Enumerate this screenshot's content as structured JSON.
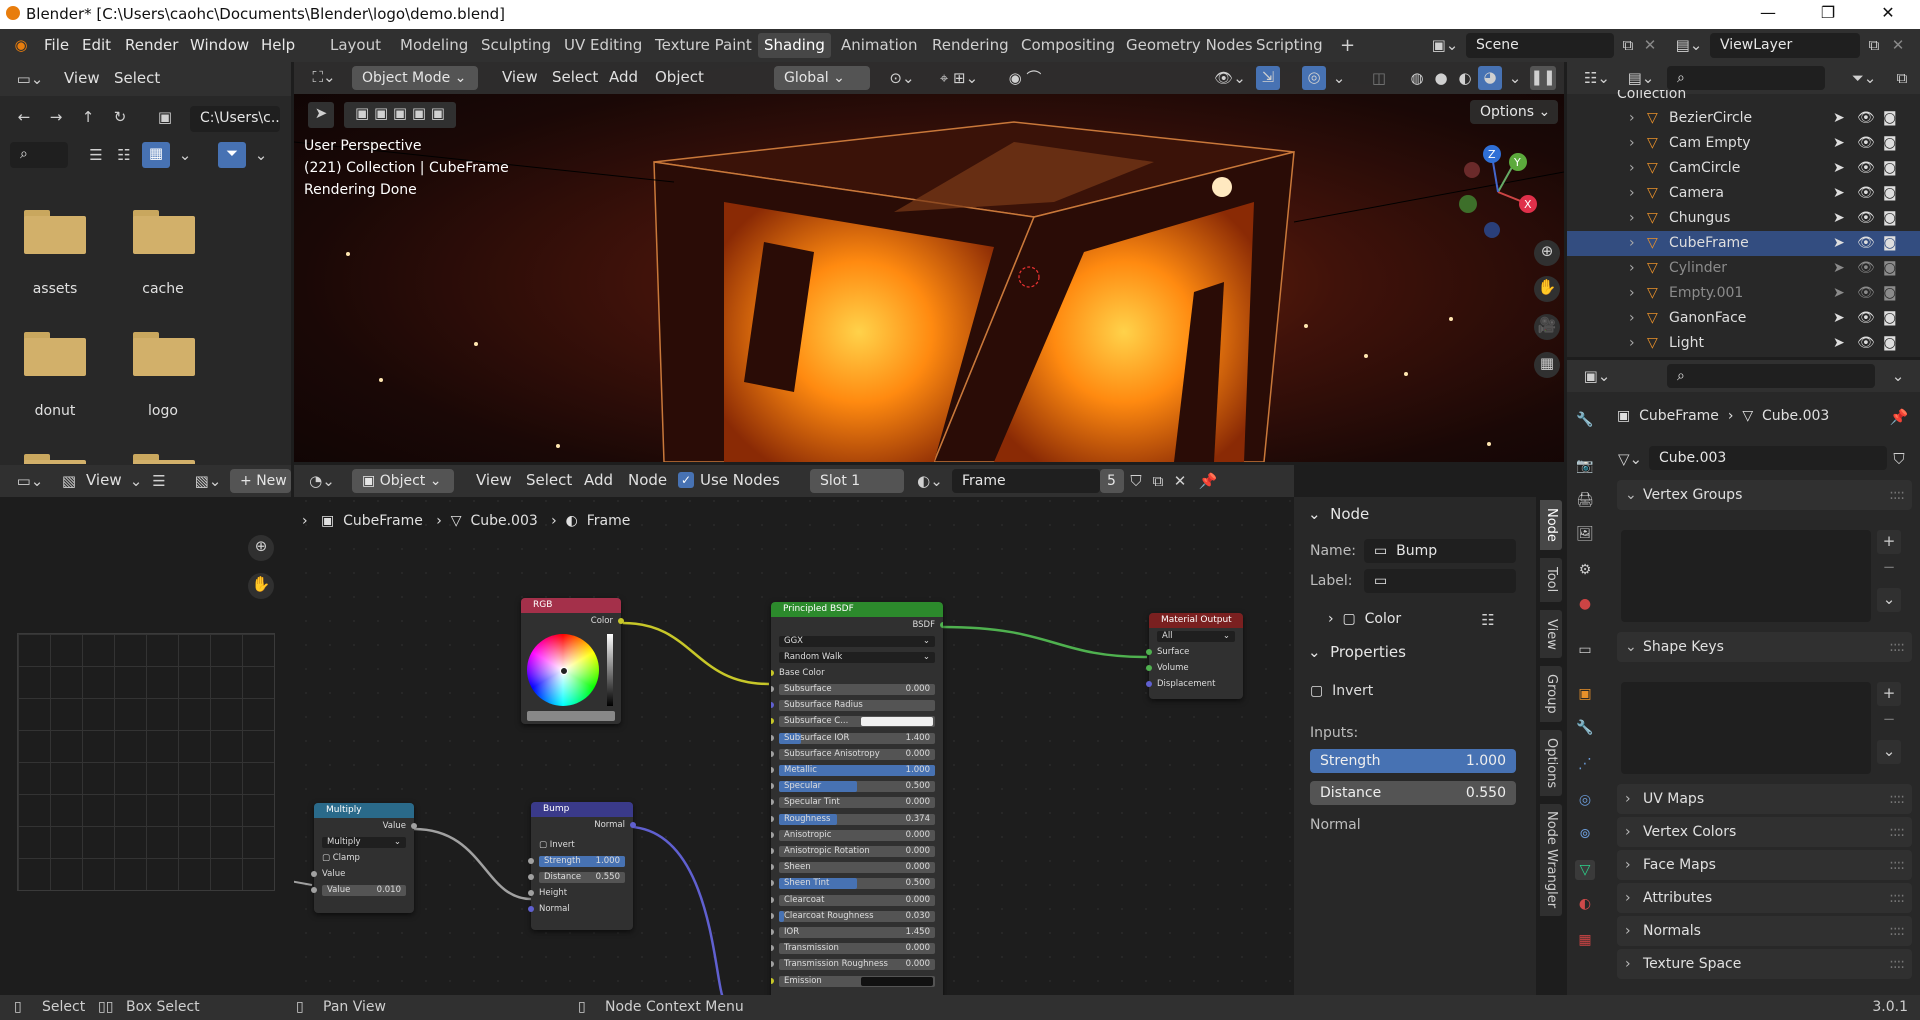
{
  "window": {
    "title": "Blender* [C:\\Users\\caohc\\Documents\\Blender\\logo\\demo.blend]",
    "controls": [
      "—",
      "❐",
      "✕"
    ]
  },
  "topbar": {
    "menus": [
      "File",
      "Edit",
      "Render",
      "Window",
      "Help"
    ],
    "workspaces": [
      "Layout",
      "Modeling",
      "Sculpting",
      "UV Editing",
      "Texture Paint",
      "Shading",
      "Animation",
      "Rendering",
      "Compositing",
      "Geometry Nodes",
      "Scripting"
    ],
    "active_workspace": "Shading",
    "add_tab": "+",
    "scene": "Scene",
    "view_layer": "ViewLayer"
  },
  "filebrowser": {
    "menus": [
      "View",
      "Select"
    ],
    "path": "C:\\Users\\c...",
    "folders": [
      "assets",
      "cache",
      "donut",
      "logo"
    ]
  },
  "viewport": {
    "mode": "Object Mode",
    "menus": [
      "View",
      "Select",
      "Add",
      "Object"
    ],
    "orientation": "Global",
    "options_label": "Options",
    "info": [
      "User Perspective",
      "(221) Collection | CubeFrame",
      "Rendering Done"
    ],
    "gizmo": {
      "x": "X",
      "y": "Y",
      "z": "Z"
    }
  },
  "imageeditor": {
    "view_label": "View",
    "new_label": "New"
  },
  "nodeeditor": {
    "type": "Object",
    "menus": [
      "View",
      "Select",
      "Add",
      "Node"
    ],
    "use_nodes_label": "Use Nodes",
    "slot": "Slot 1",
    "material": "Frame",
    "users": "5",
    "breadcrumb": [
      "CubeFrame",
      "Cube.003",
      "Frame"
    ],
    "nodes": {
      "rgb": {
        "title": "RGB",
        "output": "Color"
      },
      "principled": {
        "title": "Principled BSDF",
        "output": "BSDF",
        "distribution": "GGX",
        "subsurface_method": "Random Walk",
        "base_color": "Base Color",
        "fields": [
          {
            "label": "Subsurface",
            "value": "0.000",
            "fill": 0
          },
          {
            "label": "Subsurface Radius",
            "value": "",
            "fill": 0
          },
          {
            "label": "Subsurface C...",
            "value": "",
            "fill": 0
          },
          {
            "label": "Subsurface IOR",
            "value": "1.400",
            "fill": 0.14
          },
          {
            "label": "Subsurface Anisotropy",
            "value": "0.000",
            "fill": 0
          },
          {
            "label": "Metallic",
            "value": "1.000",
            "fill": 1
          },
          {
            "label": "Specular",
            "value": "0.500",
            "fill": 0.5
          },
          {
            "label": "Specular Tint",
            "value": "0.000",
            "fill": 0
          },
          {
            "label": "Roughness",
            "value": "0.374",
            "fill": 0.374
          },
          {
            "label": "Anisotropic",
            "value": "0.000",
            "fill": 0
          },
          {
            "label": "Anisotropic Rotation",
            "value": "0.000",
            "fill": 0
          },
          {
            "label": "Sheen",
            "value": "0.000",
            "fill": 0
          },
          {
            "label": "Sheen Tint",
            "value": "0.500",
            "fill": 0.5
          },
          {
            "label": "Clearcoat",
            "value": "0.000",
            "fill": 0
          },
          {
            "label": "Clearcoat Roughness",
            "value": "0.030",
            "fill": 0.03
          },
          {
            "label": "IOR",
            "value": "1.450",
            "fill": 0
          },
          {
            "label": "Transmission",
            "value": "0.000",
            "fill": 0
          },
          {
            "label": "Transmission Roughness",
            "value": "0.000",
            "fill": 0
          },
          {
            "label": "Emission",
            "value": "",
            "fill": 0
          }
        ]
      },
      "output": {
        "title": "Material Output",
        "target": "All",
        "inputs": [
          "Surface",
          "Volume",
          "Displacement"
        ]
      },
      "multiply": {
        "title": "Multiply",
        "output": "Value",
        "operation": "Multiply",
        "clamp": "Clamp",
        "input": "Value",
        "value_label": "Value",
        "value": "0.010"
      },
      "bump": {
        "title": "Bump",
        "output": "Normal",
        "invert": "Invert",
        "strength_label": "Strength",
        "strength": "1.000",
        "distance_label": "Distance",
        "distance": "0.550",
        "height": "Height",
        "normal": "Normal"
      }
    }
  },
  "npanel": {
    "tabs": [
      "Node",
      "Tool",
      "View",
      "Group",
      "Options",
      "Node Wrangler"
    ],
    "node_section": "Node",
    "name_label": "Name:",
    "name_value": "Bump",
    "label_label": "Label:",
    "label_value": "",
    "color_label": "Color",
    "properties_section": "Properties",
    "invert_label": "Invert",
    "inputs_label": "Inputs:",
    "strength_label": "Strength",
    "strength_value": "1.000",
    "strength_fill": 1,
    "distance_label": "Distance",
    "distance_value": "0.550",
    "normal_label": "Normal"
  },
  "outliner": {
    "collection": "Collection",
    "items": [
      {
        "name": "BezierCircle",
        "selected": false,
        "dim": false
      },
      {
        "name": "Cam Empty",
        "selected": false,
        "dim": false
      },
      {
        "name": "CamCircle",
        "selected": false,
        "dim": false
      },
      {
        "name": "Camera",
        "selected": false,
        "dim": false
      },
      {
        "name": "Chungus",
        "selected": false,
        "dim": false
      },
      {
        "name": "CubeFrame",
        "selected": true,
        "dim": false
      },
      {
        "name": "Cylinder",
        "selected": false,
        "dim": true
      },
      {
        "name": "Empty.001",
        "selected": false,
        "dim": true
      },
      {
        "name": "GanonFace",
        "selected": false,
        "dim": false
      },
      {
        "name": "Light",
        "selected": false,
        "dim": false
      }
    ]
  },
  "properties": {
    "breadcrumb": [
      "CubeFrame",
      "Cube.003"
    ],
    "mesh_name": "Cube.003",
    "sections": [
      "Vertex Groups",
      "Shape Keys",
      "UV Maps",
      "Vertex Colors",
      "Face Maps",
      "Attributes",
      "Normals",
      "Texture Space"
    ]
  },
  "statusbar": {
    "items": [
      "Select",
      "Box Select",
      "Pan View",
      "Node Context Menu"
    ],
    "version": "3.0.1"
  },
  "colors": {
    "accent": "#4772b3",
    "selection": "#334d80",
    "rgb_header": "#a4304a",
    "bsdf_header": "#2c8a2c",
    "output_header": "#7a2020",
    "vector_header": "#3a3a8a",
    "converter_header": "#2a6a8a"
  }
}
